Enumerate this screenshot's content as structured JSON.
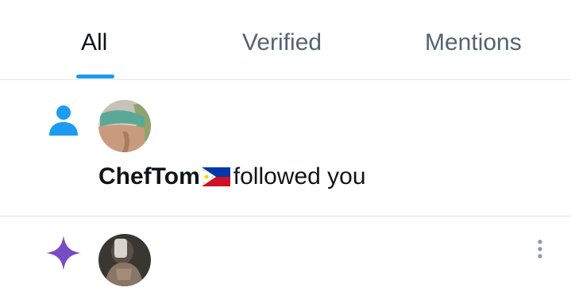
{
  "tabs": [
    {
      "label": "All",
      "active": true
    },
    {
      "label": "Verified",
      "active": false
    },
    {
      "label": "Mentions",
      "active": false
    }
  ],
  "colors": {
    "accent": "#1d9bf0",
    "text_primary": "#0f1419",
    "text_secondary": "#536471",
    "divider": "#e3e6e8",
    "recommendation_icon": "#794bc4"
  },
  "notifications": [
    {
      "type_icon": "person-icon",
      "user_name": "ChefTom",
      "flag": "philippines-flag",
      "action_text": "followed you"
    },
    {
      "type_icon": "sparkle-icon",
      "more_icon": "more-vertical-icon"
    }
  ]
}
